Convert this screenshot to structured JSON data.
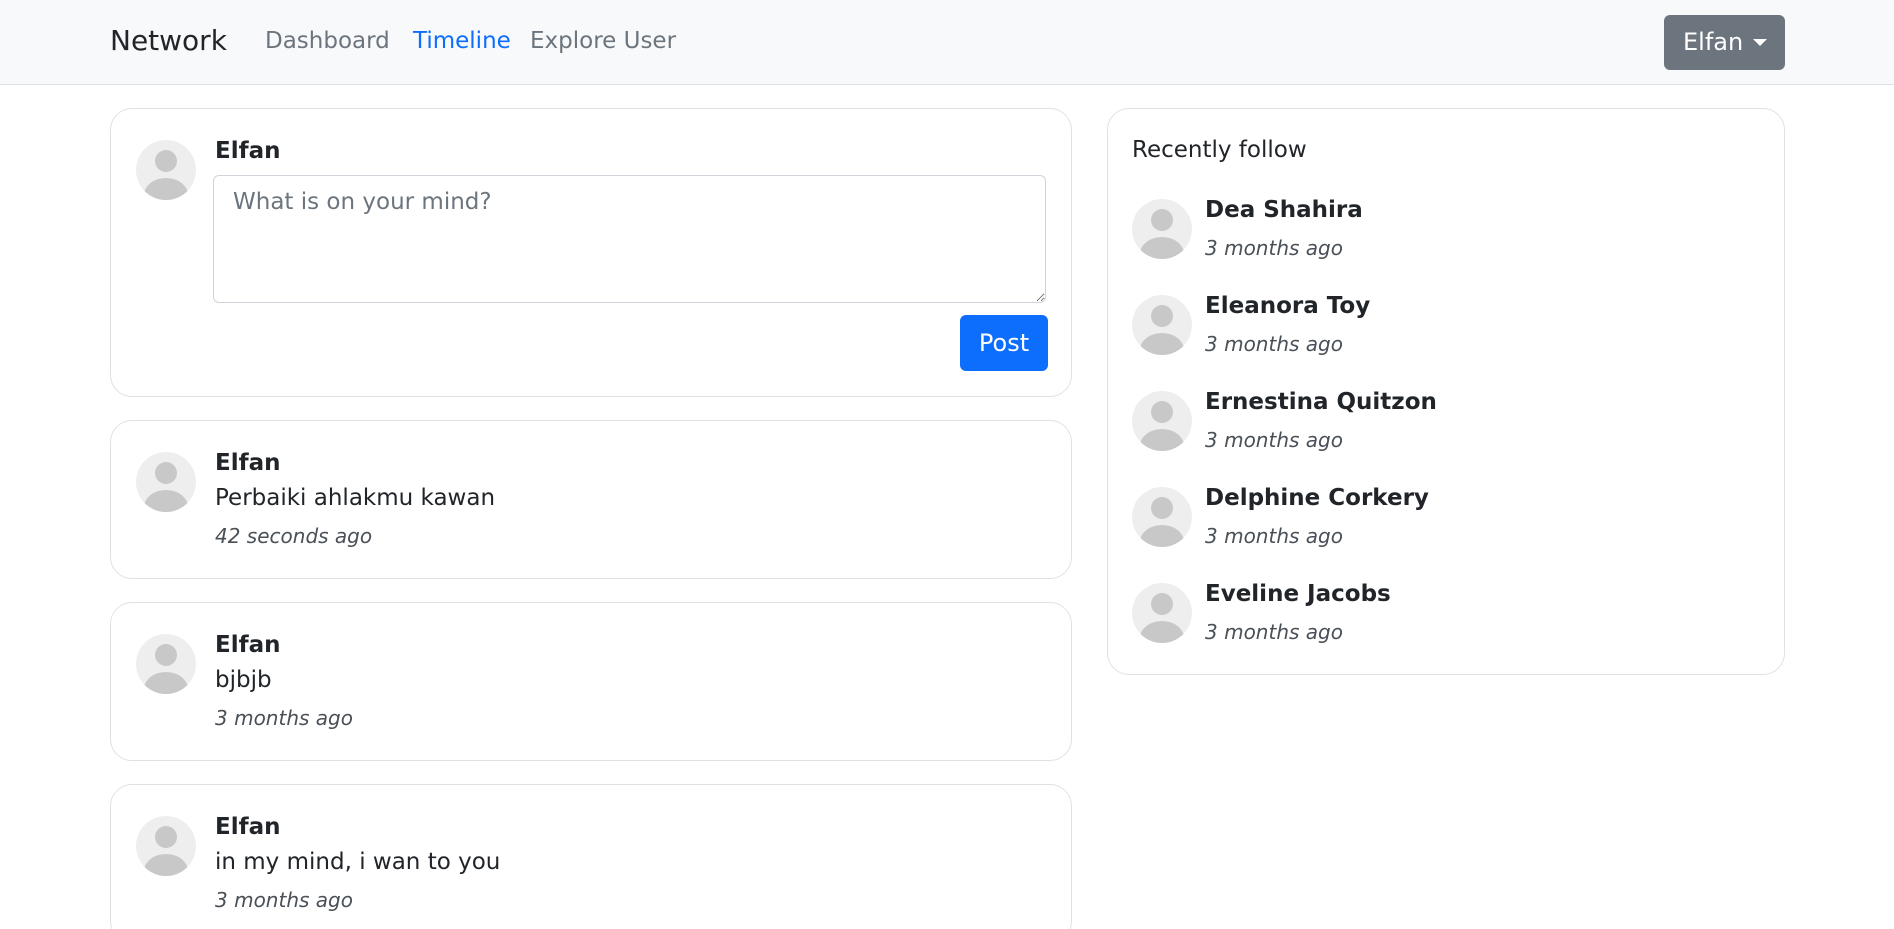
{
  "navbar": {
    "brand": "Network",
    "links": [
      {
        "label": "Dashboard"
      },
      {
        "label": "Timeline"
      },
      {
        "label": "Explore User"
      }
    ],
    "user_button": "Elfan",
    "accent_color": "#0d6efd"
  },
  "composer": {
    "user": "Elfan",
    "placeholder": "What is on your mind?",
    "post_label": "Post"
  },
  "posts": [
    {
      "user": "Elfan",
      "text": "Perbaiki ahlakmu kawan",
      "time": "42 seconds ago"
    },
    {
      "user": "Elfan",
      "text": "bjbjb",
      "time": "3 months ago"
    },
    {
      "user": "Elfan",
      "text": "in my mind, i wan to you",
      "time": "3 months ago"
    }
  ],
  "sidebar": {
    "title": "Recently follow",
    "users": [
      {
        "name": "Dea Shahira",
        "time": "3 months ago"
      },
      {
        "name": "Eleanora Toy",
        "time": "3 months ago"
      },
      {
        "name": "Ernestina Quitzon",
        "time": "3 months ago"
      },
      {
        "name": "Delphine Corkery",
        "time": "3 months ago"
      },
      {
        "name": "Eveline Jacobs",
        "time": "3 months ago"
      }
    ]
  },
  "icons": {
    "avatar": "user-avatar-icon",
    "caret": "caret-down-icon"
  }
}
